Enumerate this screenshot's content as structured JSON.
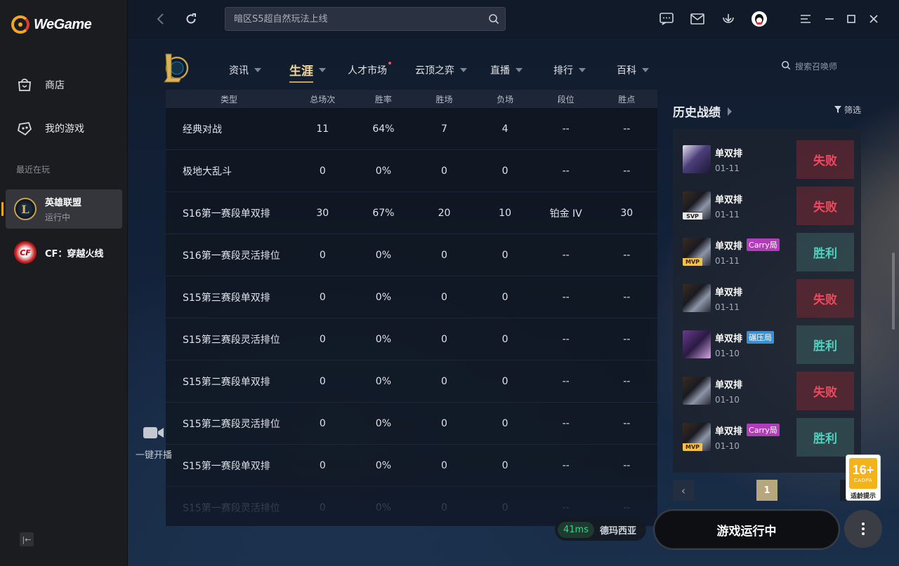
{
  "app": {
    "brand": "WeGame",
    "sidebar": {
      "nav": [
        {
          "label": "商店",
          "icon": "shopping-bag-icon"
        },
        {
          "label": "我的游戏",
          "icon": "gamepad-icon"
        }
      ],
      "recent_label": "最近在玩",
      "games": [
        {
          "name": "英雄联盟",
          "status": "运行中",
          "icon_text": "L",
          "active": true
        },
        {
          "name": "CF：穿越火线",
          "status": "",
          "icon_text": "CF",
          "active": false
        }
      ]
    },
    "topbar": {
      "search_placeholder": "暗区S5超自然玩法上线"
    },
    "game_nav": {
      "items": [
        {
          "label": "资讯",
          "caret": true
        },
        {
          "label": "生涯",
          "caret": true,
          "active": true
        },
        {
          "label": "人才市场",
          "caret": false,
          "dot": true
        },
        {
          "label": "云顶之弈",
          "caret": true
        },
        {
          "label": "直播",
          "caret": true
        },
        {
          "label": "排行",
          "caret": true
        },
        {
          "label": "百科",
          "caret": true
        }
      ],
      "summoner_search_placeholder": "搜索召唤师"
    },
    "stats_table": {
      "headers": [
        "类型",
        "总场次",
        "胜率",
        "胜场",
        "负场",
        "段位",
        "胜点"
      ],
      "rows": [
        [
          "经典对战",
          "11",
          "64%",
          "7",
          "4",
          "--",
          "--"
        ],
        [
          "极地大乱斗",
          "0",
          "0%",
          "0",
          "0",
          "--",
          "--"
        ],
        [
          "S16第一赛段单双排",
          "30",
          "67%",
          "20",
          "10",
          "铂金 IV",
          "30"
        ],
        [
          "S16第一赛段灵活排位",
          "0",
          "0%",
          "0",
          "0",
          "--",
          "--"
        ],
        [
          "S15第三赛段单双排",
          "0",
          "0%",
          "0",
          "0",
          "--",
          "--"
        ],
        [
          "S15第三赛段灵活排位",
          "0",
          "0%",
          "0",
          "0",
          "--",
          "--"
        ],
        [
          "S15第二赛段单双排",
          "0",
          "0%",
          "0",
          "0",
          "--",
          "--"
        ],
        [
          "S15第二赛段灵活排位",
          "0",
          "0%",
          "0",
          "0",
          "--",
          "--"
        ],
        [
          "S15第一赛段单双排",
          "0",
          "0%",
          "0",
          "0",
          "--",
          "--"
        ],
        [
          "S15第一赛段灵活排位",
          "0",
          "0%",
          "0",
          "0",
          "--",
          "--"
        ]
      ]
    },
    "live": {
      "label": "一键开播"
    },
    "history": {
      "title": "历史战绩",
      "filter_label": "筛选",
      "matches": [
        {
          "mode": "单双排",
          "date": "01-11",
          "result": "失败",
          "win": false,
          "avatar": "av-a",
          "badge": "",
          "tag": ""
        },
        {
          "mode": "单双排",
          "date": "01-11",
          "result": "失败",
          "win": false,
          "avatar": "av-b",
          "badge": "SVP",
          "tag": ""
        },
        {
          "mode": "单双排",
          "date": "01-11",
          "result": "胜利",
          "win": true,
          "avatar": "av-b",
          "badge": "MVP",
          "tag": "Carry局"
        },
        {
          "mode": "单双排",
          "date": "01-11",
          "result": "失败",
          "win": false,
          "avatar": "av-b",
          "badge": "",
          "tag": ""
        },
        {
          "mode": "单双排",
          "date": "01-10",
          "result": "胜利",
          "win": true,
          "avatar": "av-c",
          "badge": "",
          "tag": "碾压局"
        },
        {
          "mode": "单双排",
          "date": "01-10",
          "result": "失败",
          "win": false,
          "avatar": "av-b",
          "badge": "",
          "tag": ""
        },
        {
          "mode": "单双排",
          "date": "01-10",
          "result": "胜利",
          "win": true,
          "avatar": "av-b",
          "badge": "MVP",
          "tag": "Carry局"
        }
      ],
      "page": "1"
    },
    "age_rating": {
      "number": "16+",
      "sub": "CADPA",
      "text": "适龄提示"
    },
    "bottom": {
      "ping": "41ms",
      "server": "德玛西亚",
      "play_label": "游戏运行中"
    }
  }
}
